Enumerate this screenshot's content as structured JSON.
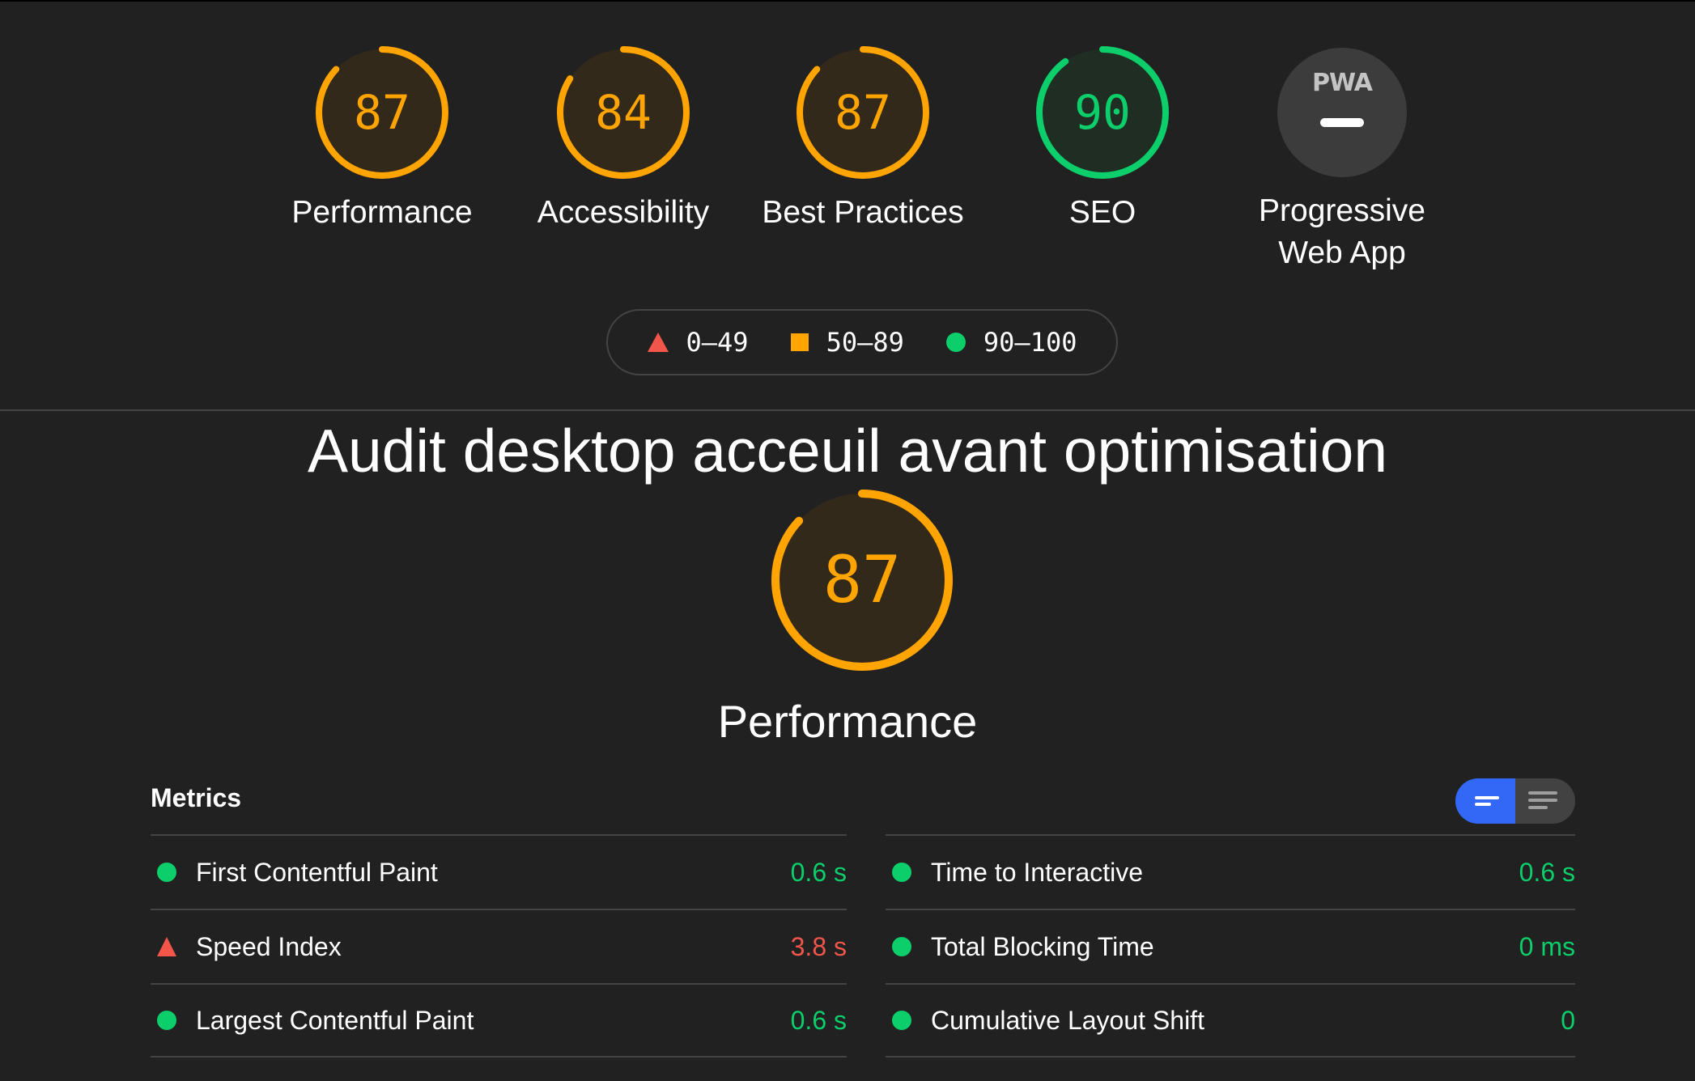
{
  "categories": [
    {
      "score": "87",
      "label": "Performance",
      "status": "average",
      "fraction": 0.87
    },
    {
      "score": "84",
      "label": "Accessibility",
      "status": "average",
      "fraction": 0.84
    },
    {
      "score": "87",
      "label": "Best Practices",
      "status": "average",
      "fraction": 0.87
    },
    {
      "score": "90",
      "label": "SEO",
      "status": "pass",
      "fraction": 0.9
    }
  ],
  "pwa": {
    "badge_text": "PWA",
    "label_line1": "Progressive",
    "label_line2": "Web App",
    "icon": "pwa-badge-icon"
  },
  "legend": {
    "fail": "0–49",
    "average": "50–89",
    "pass": "90–100"
  },
  "audit_title": "Audit desktop acceuil avant optimisation",
  "main_gauge": {
    "score": "87",
    "label": "Performance",
    "fraction": 0.87
  },
  "metrics": {
    "header": "Metrics",
    "left": [
      {
        "name": "First Contentful Paint",
        "value": "0.6 s",
        "status": "pass"
      },
      {
        "name": "Speed Index",
        "value": "3.8 s",
        "status": "fail"
      },
      {
        "name": "Largest Contentful Paint",
        "value": "0.6 s",
        "status": "pass"
      }
    ],
    "right": [
      {
        "name": "Time to Interactive",
        "value": "0.6 s",
        "status": "pass"
      },
      {
        "name": "Total Blocking Time",
        "value": "0 ms",
        "status": "pass"
      },
      {
        "name": "Cumulative Layout Shift",
        "value": "0",
        "status": "pass"
      }
    ]
  },
  "colors": {
    "background": "#212121",
    "average": "#ffa400",
    "average_fill": "#33291b",
    "pass": "#0cce6b",
    "pass_fill": "#1f2d22",
    "fail": "#f2564a",
    "toggle_active": "#3367f5"
  }
}
